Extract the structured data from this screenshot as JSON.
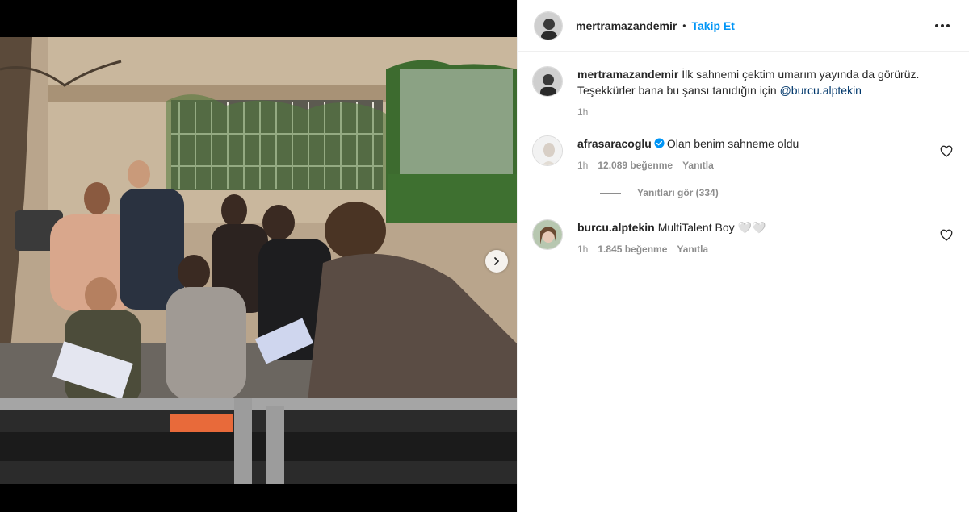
{
  "post": {
    "author": "mertramazandemir",
    "follow_label": "Takip Et",
    "separator": "•"
  },
  "caption": {
    "username": "mertramazandemir",
    "text": "İlk sahnemi çektim umarım yayında da görürüz. Teşekkürler bana bu şansı tanıdığın için ",
    "mention": "@burcu.alptekin",
    "time": "1h"
  },
  "comments": [
    {
      "username": "afrasaracoglu",
      "verified": true,
      "text": "Olan benim sahneme oldu",
      "time": "1h",
      "likes": "12.089 beğenme",
      "reply_label": "Yanıtla",
      "view_replies": "Yanıtları gör (334)"
    },
    {
      "username": "burcu.alptekin",
      "verified": false,
      "text": "MultiTalent Boy 🤍🤍",
      "time": "1h",
      "likes": "1.845 beğenme",
      "reply_label": "Yanıtla"
    }
  ],
  "icons": {
    "more": "more-options-icon",
    "heart": "heart-icon",
    "verified": "verified-badge-icon",
    "next": "chevron-right-icon"
  },
  "colors": {
    "link": "#0095f6",
    "mention": "#00376b",
    "muted": "#8e8e8e",
    "verified": "#0095f6"
  }
}
